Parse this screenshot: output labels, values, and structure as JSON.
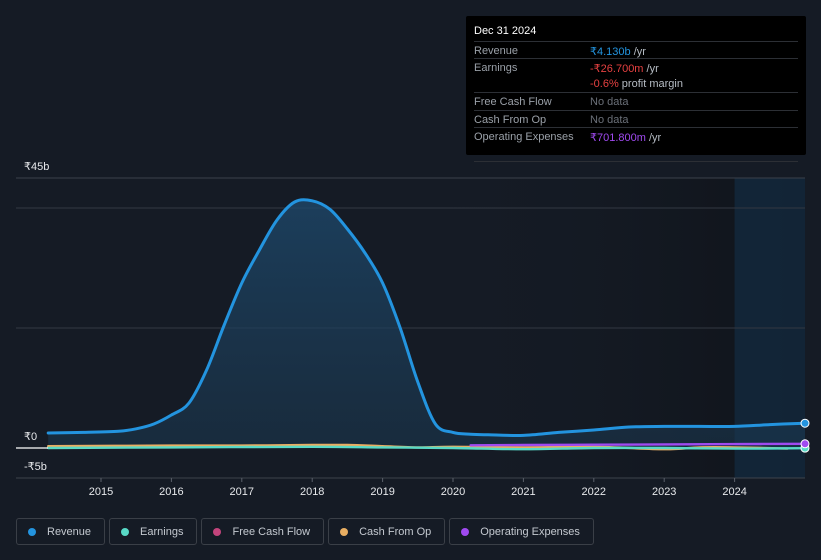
{
  "tooltip": {
    "date": "Dec 31 2024",
    "rows": [
      {
        "label": "Revenue",
        "value": "₹4.130b",
        "unit": " /yr",
        "color": "#2394df"
      },
      {
        "label": "Earnings",
        "value": "-₹26.700m",
        "unit": " /yr",
        "color": "#e64141"
      },
      {
        "label": "",
        "value": "-0.6%",
        "unit": " profit margin",
        "color": "#e64141"
      },
      {
        "label": "Free Cash Flow",
        "value": "No data",
        "unit": "",
        "color": "#6b7079"
      },
      {
        "label": "Cash From Op",
        "value": "No data",
        "unit": "",
        "color": "#6b7079"
      },
      {
        "label": "Operating Expenses",
        "value": "₹701.800m",
        "unit": " /yr",
        "color": "#a04af0"
      }
    ]
  },
  "legend": [
    {
      "label": "Revenue",
      "color": "#2394df"
    },
    {
      "label": "Earnings",
      "color": "#58d9c6"
    },
    {
      "label": "Free Cash Flow",
      "color": "#c2447c"
    },
    {
      "label": "Cash From Op",
      "color": "#e8ae62"
    },
    {
      "label": "Operating Expenses",
      "color": "#a04af0"
    }
  ],
  "chart_data": {
    "type": "area",
    "title": "",
    "xlabel": "",
    "ylabel": "",
    "unit": "₹ billions",
    "ylim": [
      -5,
      45
    ],
    "xlim": [
      2014.25,
      2025.0
    ],
    "y_tick_labels": [
      {
        "value": 45,
        "label": "₹45b"
      },
      {
        "value": 0,
        "label": "₹0"
      },
      {
        "value": -5,
        "label": "-₹5b"
      }
    ],
    "gridlines": [
      40,
      20
    ],
    "x_ticks": [
      2015,
      2016,
      2017,
      2018,
      2019,
      2020,
      2021,
      2022,
      2023,
      2024
    ],
    "forecast_shade_start": 2024.0,
    "series": [
      {
        "name": "Revenue",
        "color": "#2394df",
        "filled": true,
        "x": [
          2014.25,
          2014.75,
          2015.25,
          2015.5,
          2015.75,
          2016.0,
          2016.25,
          2016.5,
          2016.75,
          2017.0,
          2017.25,
          2017.5,
          2017.75,
          2018.0,
          2018.25,
          2018.5,
          2018.75,
          2019.0,
          2019.25,
          2019.5,
          2019.75,
          2020.0,
          2020.25,
          2020.5,
          2021.0,
          2021.5,
          2022.0,
          2022.5,
          2023.0,
          2023.5,
          2024.0,
          2024.5,
          2025.0
        ],
        "y": [
          2.5,
          2.6,
          2.8,
          3.2,
          4.0,
          5.5,
          7.5,
          13,
          20.5,
          27.5,
          33,
          38,
          41,
          41.2,
          39.8,
          36.5,
          32.5,
          27.5,
          20,
          11,
          4,
          2.6,
          2.3,
          2.2,
          2.1,
          2.6,
          3.0,
          3.5,
          3.6,
          3.6,
          3.6,
          3.9,
          4.13
        ]
      },
      {
        "name": "Earnings",
        "color": "#58d9c6",
        "x": [
          2014.25,
          2016.0,
          2018.0,
          2019.0,
          2020.0,
          2021.0,
          2022.0,
          2023.0,
          2024.0,
          2025.0
        ],
        "y": [
          0.0,
          0.1,
          0.2,
          0.1,
          0.0,
          -0.2,
          0.0,
          0.0,
          -0.1,
          -0.03
        ]
      },
      {
        "name": "Cash From Op",
        "color": "#e8ae62",
        "x": [
          2014.25,
          2016.0,
          2017.0,
          2018.0,
          2018.5,
          2019.0,
          2019.5,
          2020.0,
          2021.0,
          2022.0,
          2023.0,
          2023.5,
          2024.0,
          2024.75
        ],
        "y": [
          0.3,
          0.4,
          0.4,
          0.5,
          0.5,
          0.3,
          0.1,
          0.2,
          0.1,
          0.2,
          -0.2,
          0.1,
          0.1,
          -0.1
        ]
      },
      {
        "name": "Operating Expenses",
        "color": "#a04af0",
        "x": [
          2020.25,
          2021.0,
          2022.0,
          2023.0,
          2024.0,
          2025.0
        ],
        "y": [
          0.45,
          0.5,
          0.55,
          0.6,
          0.65,
          0.7
        ]
      }
    ]
  }
}
